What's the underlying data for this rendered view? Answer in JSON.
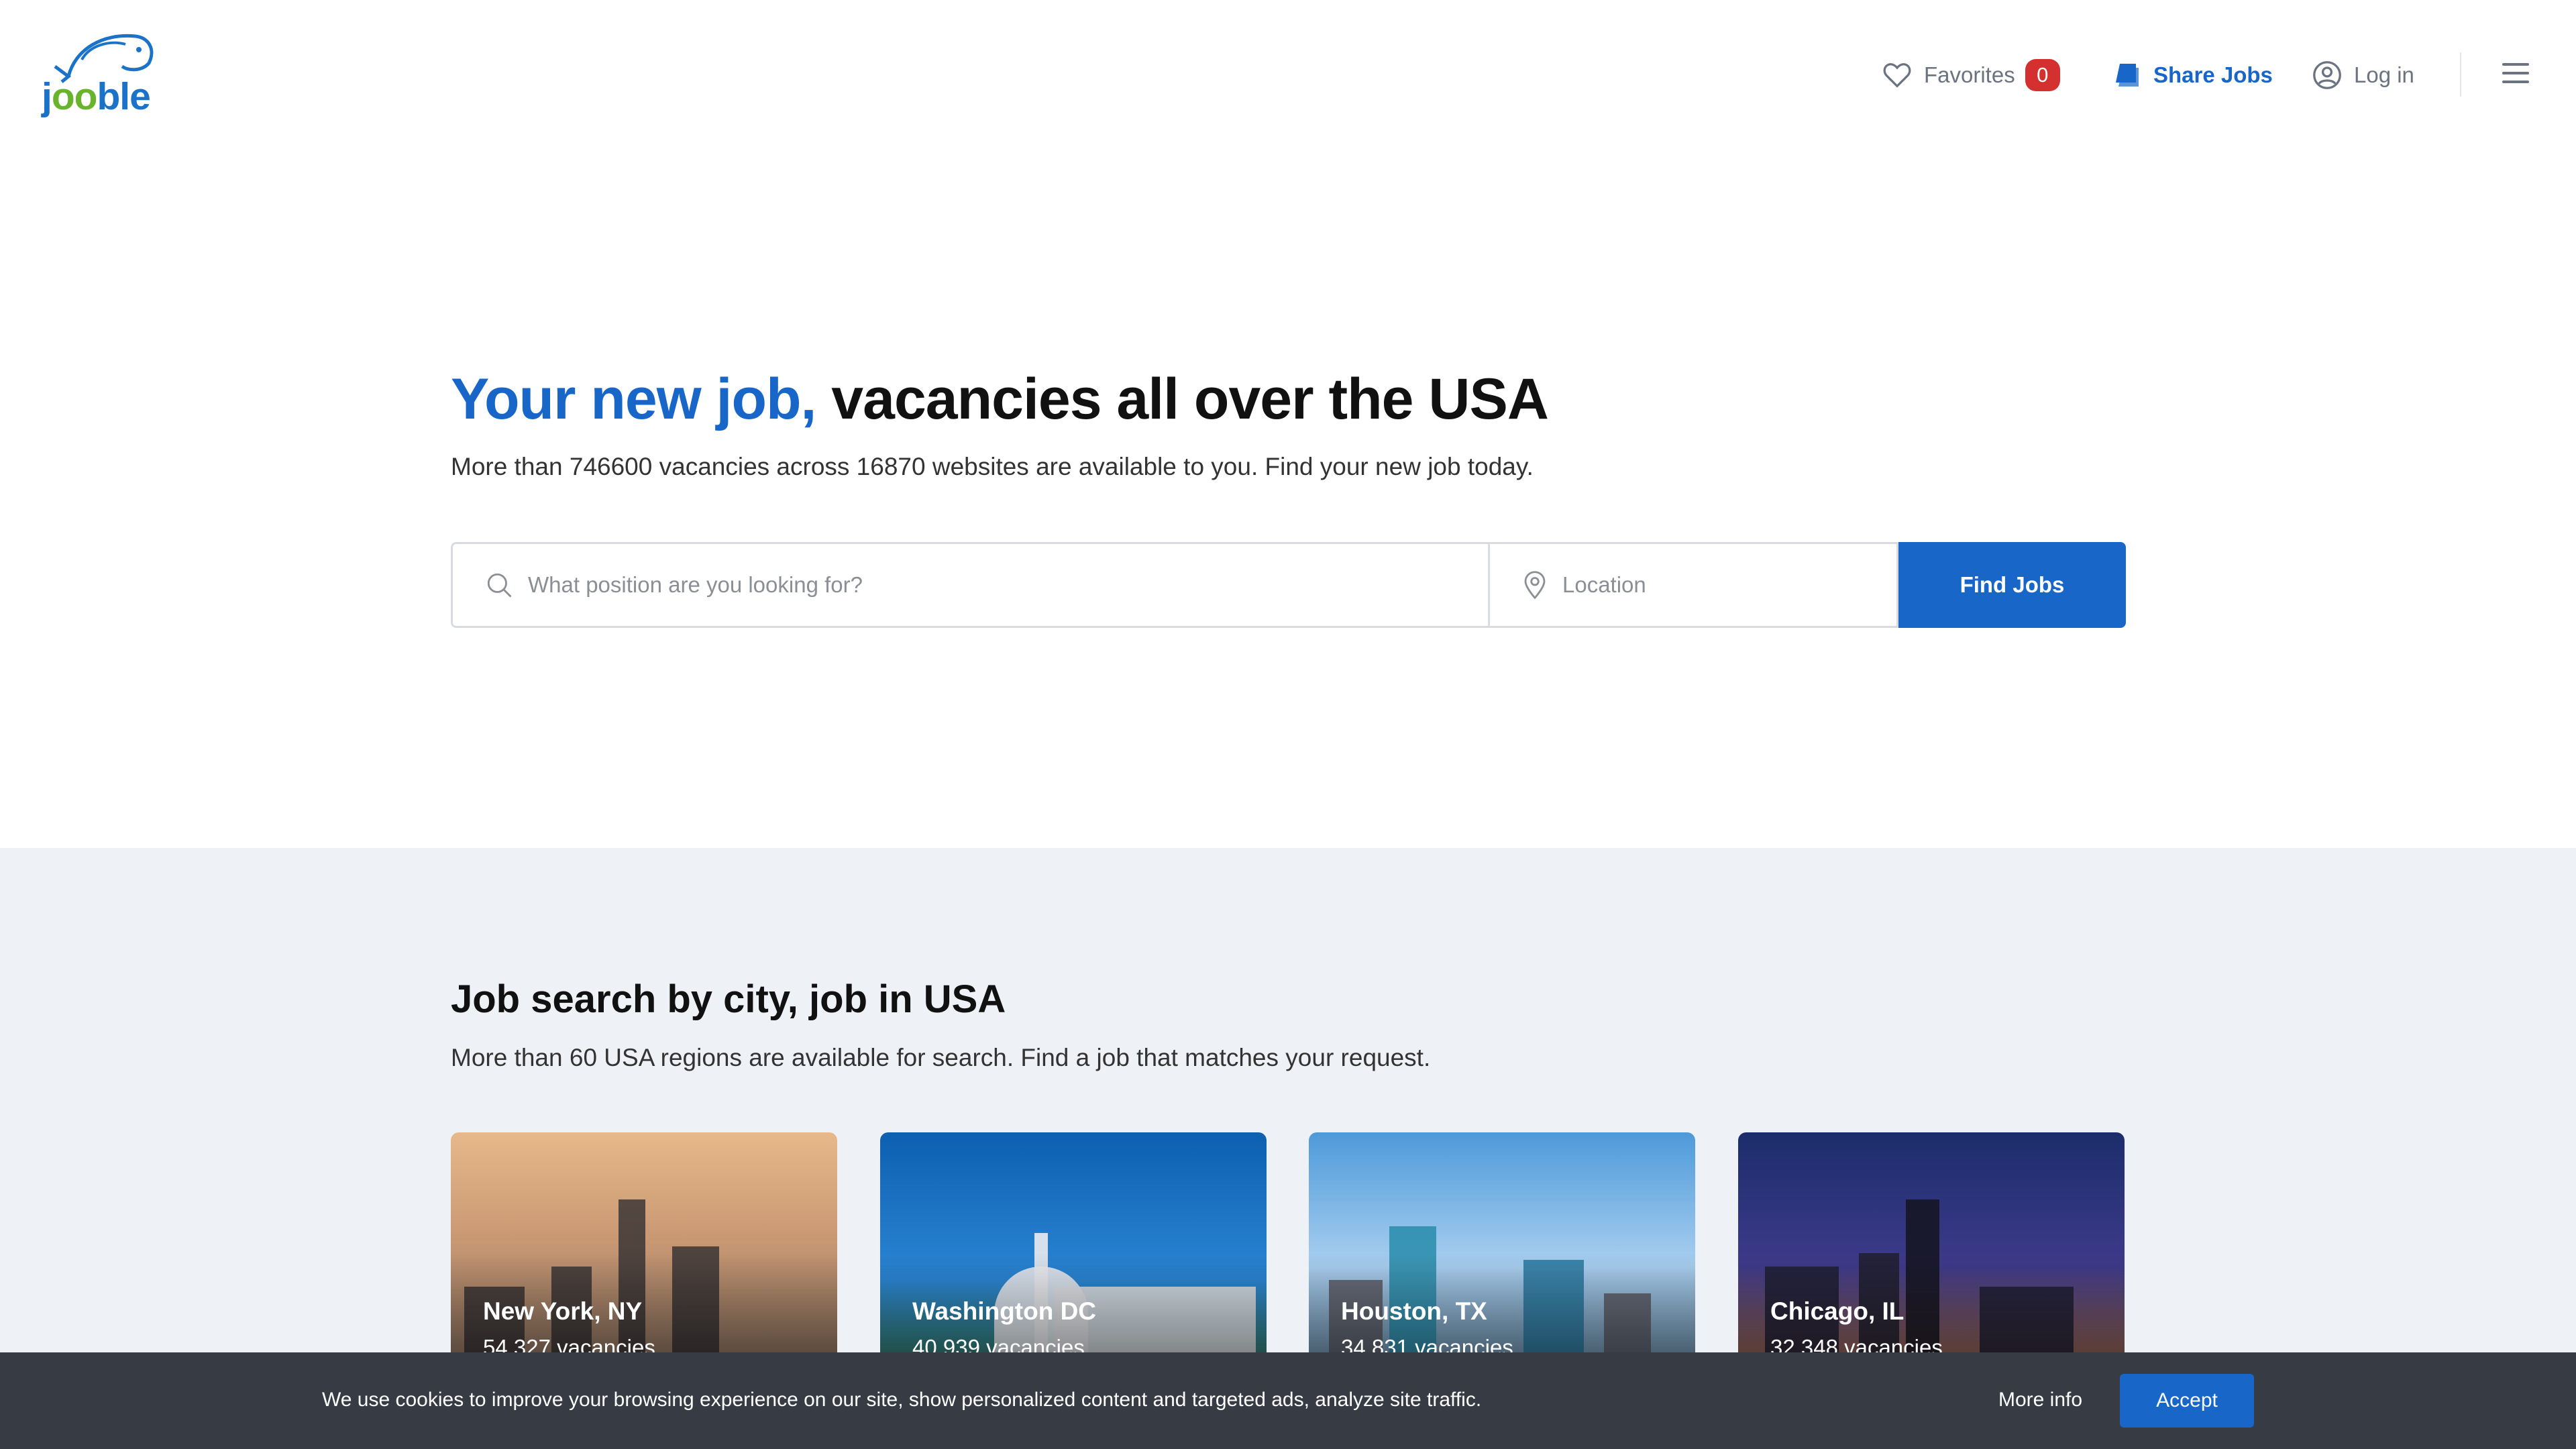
{
  "header": {
    "logo": {
      "text_j": "j",
      "text_oo": "oo",
      "text_ble": "ble"
    },
    "favorites_label": "Favorites",
    "favorites_count": "0",
    "share_jobs_label": "Share Jobs",
    "login_label": "Log in"
  },
  "hero": {
    "title_accent": "Your new job,",
    "title_rest": " vacancies all over the USA",
    "subtitle": "More than 746600 vacancies across 16870 websites are available to you. Find your new job today.",
    "position_placeholder": "What position are you looking for?",
    "location_placeholder": "Location",
    "find_button": "Find Jobs"
  },
  "cities": {
    "title": "Job search by city, job in USA",
    "subtitle": "More than 60 USA regions are available for search. Find a job that matches your request.",
    "items": [
      {
        "name": "New York, NY",
        "count": "54 327 vacancies"
      },
      {
        "name": "Washington DC",
        "count": "40 939 vacancies"
      },
      {
        "name": "Houston, TX",
        "count": "34 831 vacancies"
      },
      {
        "name": "Chicago, IL",
        "count": "32 348 vacancies"
      }
    ]
  },
  "cookie": {
    "text": "We use cookies to improve your browsing experience on our site, show personalized content and targeted ads, analyze site traffic.",
    "more_info": "More info",
    "accept": "Accept"
  },
  "colors": {
    "brand_blue": "#1866c8",
    "brand_green": "#6ab42d",
    "badge_red": "#d3302f",
    "section_bg": "#eef2f6",
    "cookie_bg": "#363b44"
  }
}
